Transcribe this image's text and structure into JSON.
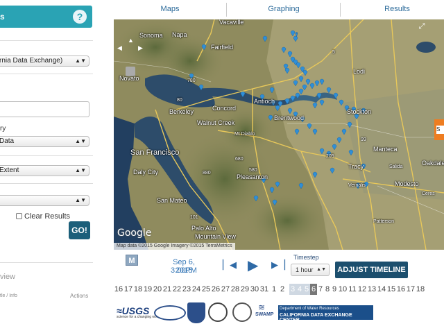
{
  "left_panel": {
    "header_title": "s",
    "help_icon": "?",
    "agency_select": "rnia Data Exchange)",
    "label_category": "ry",
    "data_select": " Data",
    "extent_select": "Extent",
    "empty_select": "",
    "clear_results_label": "Clear Results",
    "go_button": "GO!",
    "results_title": "view",
    "col_title": "tle / Info",
    "col_actions": "Actions"
  },
  "tabs": [
    "Maps",
    "Graphing",
    "Results"
  ],
  "map": {
    "cities": {
      "sonoma": "Sonoma",
      "napa": "Napa",
      "vacaville": "Vacaville",
      "fairfield": "Fairfield",
      "novato": "Novato",
      "concord": "Concord",
      "antioch": "Antioch",
      "brentwood": "Brentwood",
      "stockton": "Stockton",
      "lodi": "Lodi",
      "walnut_creek": "Walnut Creek",
      "berkeley": "Berkeley",
      "mt_diablo": "Mt Diablo",
      "san_francisco": "San Francisco",
      "daly_city": "Daly City",
      "pleasanton": "Pleasanton",
      "san_mateo": "San Mateo",
      "palo_alto": "Palo Alto",
      "mountain_view": "Mountain View",
      "manteca": "Manteca",
      "modesto": "Modesto",
      "tracy": "Tracy",
      "oakdale": "Oakdale",
      "salida": "Salida",
      "patterson": "Patterson",
      "vernalis": "Vernalis",
      "ceres": "Ceres"
    },
    "road_labels": [
      "80",
      "680",
      "580",
      "205",
      "5",
      "99",
      "780",
      "880",
      "101"
    ],
    "google_logo": "Google",
    "attribution": "Map data ©2015 Google Imagery ©2015 TerraMetrics",
    "marker_label": "S"
  },
  "timeline": {
    "m_logo": "M",
    "date": "Sep 6, 2015",
    "time": "3:00PM",
    "timestep_label": "Timestep",
    "timestep_value": "1 hour",
    "adjust_button": "ADJUST TIMELINE",
    "days": [
      "16",
      "17",
      "18",
      "19",
      "20",
      "21",
      "22",
      "23",
      "24",
      "25",
      "26",
      "27",
      "28",
      "29",
      "30",
      "31",
      "1",
      "2",
      "3",
      "4",
      "5",
      "6",
      "7",
      "8",
      "9",
      "10",
      "11",
      "12",
      "13",
      "14",
      "15",
      "16",
      "17",
      "18"
    ]
  },
  "logos": {
    "usgs": "≈USGS",
    "usgs_tagline": "science for a changing world",
    "dwr_line1": "Department of Water Resources",
    "dwr_line2": "CALIFORNIA DATA EXCHANGE CENTER",
    "swamp": "SWAMP"
  },
  "colors": {
    "accent": "#2aa3b4",
    "button_dark": "#1c4f6e",
    "link_blue": "#2b6a9a",
    "marker_blue": "#2f8fd8",
    "marker_orange": "#ee7d21"
  }
}
